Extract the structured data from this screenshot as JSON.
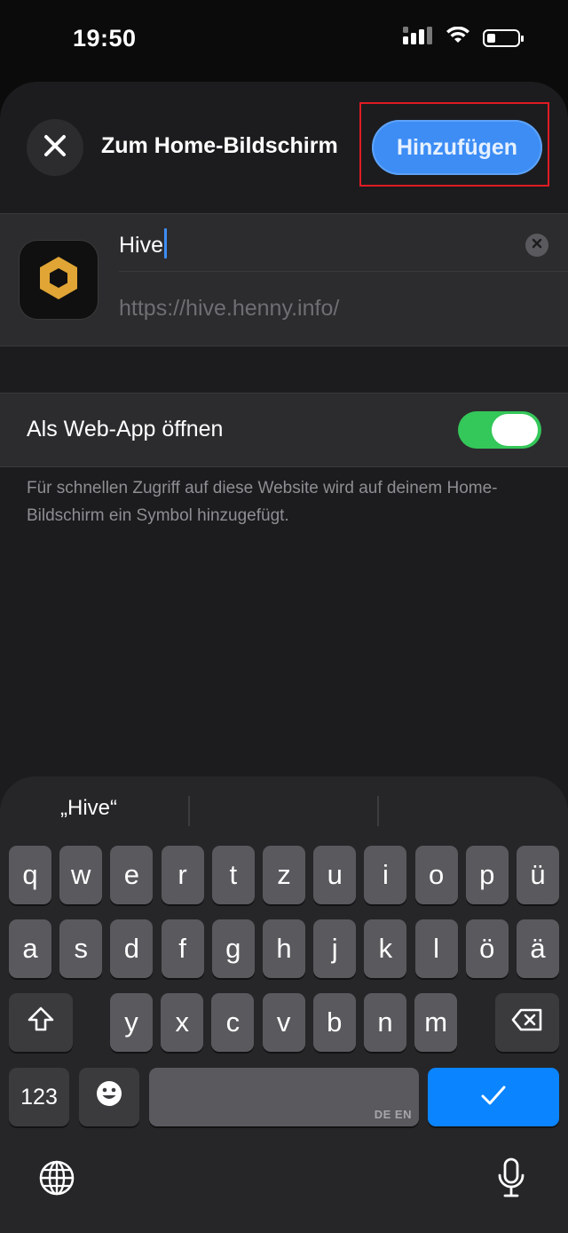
{
  "status_bar": {
    "time": "19:50",
    "icons": [
      "cellular-signal-icon",
      "wifi-icon",
      "battery-icon"
    ]
  },
  "sheet": {
    "title": "Zum Home-Bildschirm",
    "add_label": "Hinzufügen",
    "close_icon": "close-icon"
  },
  "bookmark": {
    "name_value": "Hive",
    "url": "https://hive.henny.info/",
    "app_icon": "hive-hexagon-logo-icon"
  },
  "web_app": {
    "label": "Als Web-App öffnen",
    "enabled": true
  },
  "footnote": "Für schnellen Zugriff auf diese Website wird auf deinem Home-Bildschirm ein Symbol hinzugefügt.",
  "keyboard": {
    "suggestions": [
      "„Hive“",
      "",
      ""
    ],
    "row1": [
      "q",
      "w",
      "e",
      "r",
      "t",
      "z",
      "u",
      "i",
      "o",
      "p",
      "ü"
    ],
    "row2": [
      "a",
      "s",
      "d",
      "f",
      "g",
      "h",
      "j",
      "k",
      "l",
      "ö",
      "ä"
    ],
    "row3": [
      "y",
      "x",
      "c",
      "v",
      "b",
      "n",
      "m"
    ],
    "numbers_label": "123",
    "space_language": "DE EN",
    "shift_icon": "shift-icon",
    "delete_icon": "delete-icon",
    "emoji_icon": "emoji-icon",
    "done_icon": "checkmark-icon",
    "globe_icon": "globe-icon",
    "mic_icon": "microphone-icon",
    "accent_color": "#0a84ff"
  },
  "colors": {
    "add_button": "#3d8df5",
    "toggle_on": "#34c759",
    "highlight_border": "#e01b24",
    "logo": "#e0a535"
  }
}
